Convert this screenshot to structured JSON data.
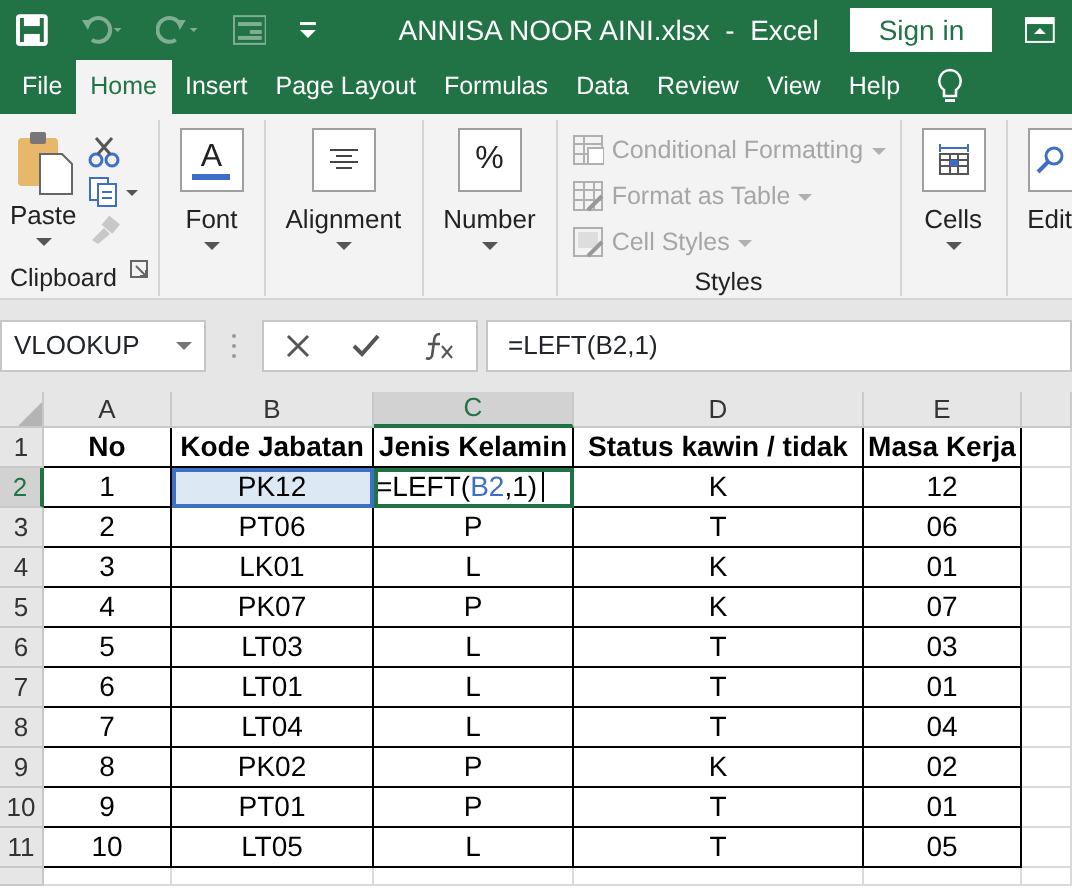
{
  "title_bar": {
    "title": "ANNISA NOOR AINI.xlsx  -  Excel",
    "sign_in": "Sign in"
  },
  "tabs": [
    {
      "label": "File",
      "selected": false
    },
    {
      "label": "Home",
      "selected": true
    },
    {
      "label": "Insert",
      "selected": false
    },
    {
      "label": "Page Layout",
      "selected": false
    },
    {
      "label": "Formulas",
      "selected": false
    },
    {
      "label": "Data",
      "selected": false
    },
    {
      "label": "Review",
      "selected": false
    },
    {
      "label": "View",
      "selected": false
    },
    {
      "label": "Help",
      "selected": false
    }
  ],
  "clipboard": {
    "paste": "Paste",
    "label": "Clipboard"
  },
  "launchers": [
    {
      "kind": "font",
      "label": "Font",
      "glyph": "A"
    },
    {
      "kind": "alignment",
      "label": "Alignment"
    },
    {
      "kind": "number",
      "label": "Number",
      "glyph": "%"
    }
  ],
  "styles": {
    "label": "Styles",
    "items": [
      {
        "kind": "conditional",
        "label": "Conditional Formatting",
        "disabled": true
      },
      {
        "kind": "table",
        "label": "Format as Table",
        "disabled": true
      },
      {
        "kind": "cellstyle",
        "label": "Cell Styles",
        "disabled": true
      }
    ]
  },
  "cells_group": {
    "label": "Cells"
  },
  "editing_group": {
    "label": "Edit"
  },
  "formula_bar": {
    "name_box": "VLOOKUP",
    "formula": "=LEFT(B2,1)"
  },
  "sheet": {
    "columns": [
      {
        "label": "A",
        "selected": false
      },
      {
        "label": "B",
        "selected": false
      },
      {
        "label": "C",
        "selected": true
      },
      {
        "label": "D",
        "selected": false
      },
      {
        "label": "E",
        "selected": false
      }
    ],
    "rows": [
      {
        "label": "1",
        "selected": false,
        "kind": "header",
        "cells": [
          "No",
          "Kode Jabatan",
          "Jenis Kelamin",
          "Status kawin / tidak",
          "Masa Kerja"
        ]
      },
      {
        "label": "2",
        "selected": true,
        "kind": "data",
        "cells": [
          "1",
          {
            "kind": "ref",
            "text": "PK12"
          },
          {
            "kind": "editing",
            "parts": [
              {
                "text": "=LEFT("
              },
              {
                "text": "B2",
                "ref": true
              },
              {
                "text": ",1)"
              }
            ]
          },
          "K",
          "12"
        ]
      },
      {
        "label": "3",
        "selected": false,
        "kind": "data",
        "cells": [
          "2",
          "PT06",
          "P",
          "T",
          "06"
        ]
      },
      {
        "label": "4",
        "selected": false,
        "kind": "data",
        "cells": [
          "3",
          "LK01",
          "L",
          "K",
          "01"
        ]
      },
      {
        "label": "5",
        "selected": false,
        "kind": "data",
        "cells": [
          "4",
          "PK07",
          "P",
          "K",
          "07"
        ]
      },
      {
        "label": "6",
        "selected": false,
        "kind": "data",
        "cells": [
          "5",
          "LT03",
          "L",
          "T",
          "03"
        ]
      },
      {
        "label": "7",
        "selected": false,
        "kind": "data",
        "cells": [
          "6",
          "LT01",
          "L",
          "T",
          "01"
        ]
      },
      {
        "label": "8",
        "selected": false,
        "kind": "data",
        "cells": [
          "7",
          "LT04",
          "L",
          "T",
          "04"
        ]
      },
      {
        "label": "9",
        "selected": false,
        "kind": "data",
        "cells": [
          "8",
          "PK02",
          "P",
          "K",
          "02"
        ]
      },
      {
        "label": "10",
        "selected": false,
        "kind": "data",
        "cells": [
          "9",
          "PT01",
          "P",
          "T",
          "01"
        ]
      },
      {
        "label": "11",
        "selected": false,
        "kind": "data",
        "cells": [
          "10",
          "LT05",
          "L",
          "T",
          "05"
        ]
      }
    ]
  }
}
